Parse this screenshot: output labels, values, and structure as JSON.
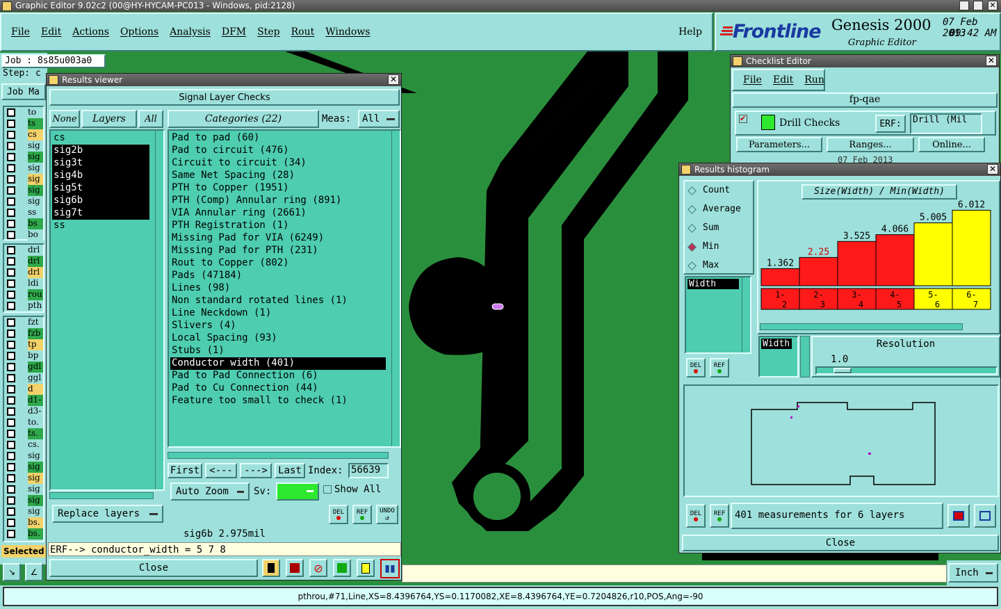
{
  "window_title": "Graphic Editor 9.02c2 (00@HY-HYCAM-PC013 - Windows, pid:2128)",
  "menu": [
    "File",
    "Edit",
    "Actions",
    "Options",
    "Analysis",
    "DFM",
    "Step",
    "Rout",
    "Windows"
  ],
  "help_label": "Help",
  "brand": {
    "logo": "Frontline",
    "product": "Genesis 2000",
    "sub": "Graphic Editor",
    "date": "07 Feb 2013",
    "time": "09:42 AM"
  },
  "left_panel": {
    "job": "Job : 8s85u003a0",
    "step": "Step: c",
    "job_button": "Job Ma",
    "layers_a": [
      "to",
      "ts",
      "cs",
      "sig",
      "sig",
      "sig",
      "sig",
      "sig",
      "sig",
      "ss",
      "bs",
      "bo"
    ],
    "layers_b": [
      "drl",
      "drl",
      "drl",
      "ldi",
      "rou",
      "pth"
    ],
    "layers_c": [
      "fzt",
      "fzb",
      "tp",
      "bp",
      "gdl",
      "ggl",
      "d",
      "d1-",
      "d3-",
      "to.",
      "ts.",
      "cs.",
      "sig",
      "sig",
      "sig",
      "sig",
      "sig",
      "sig",
      "bs.",
      "bs."
    ],
    "selected_label": "Selected"
  },
  "results_viewer": {
    "title": "Results viewer",
    "header": "Signal Layer Checks",
    "none_label": "None",
    "layers_label": "Layers",
    "all_label": "All",
    "layers": [
      {
        "name": "cs",
        "selected": false
      },
      {
        "name": "sig2b",
        "selected": true
      },
      {
        "name": "sig3t",
        "selected": true
      },
      {
        "name": "sig4b",
        "selected": true
      },
      {
        "name": "sig5t",
        "selected": true
      },
      {
        "name": "sig6b",
        "selected": true
      },
      {
        "name": "sig7t",
        "selected": true
      },
      {
        "name": "ss",
        "selected": false
      }
    ],
    "categories_label": "Categories (22)",
    "meas_label": "Meas:",
    "meas_value": "All",
    "categories": [
      {
        "name": "Pad to pad (60)",
        "selected": false
      },
      {
        "name": "Pad to circuit (476)",
        "selected": false
      },
      {
        "name": "Circuit to circuit (34)",
        "selected": false
      },
      {
        "name": "Same Net Spacing (28)",
        "selected": false
      },
      {
        "name": "PTH to Copper (1951)",
        "selected": false
      },
      {
        "name": "PTH (Comp) Annular ring (891)",
        "selected": false
      },
      {
        "name": "VIA Annular ring (2661)",
        "selected": false
      },
      {
        "name": "PTH Registration (1)",
        "selected": false
      },
      {
        "name": "Missing Pad for VIA (6249)",
        "selected": false
      },
      {
        "name": "Missing Pad for PTH (231)",
        "selected": false
      },
      {
        "name": "Rout to Copper (802)",
        "selected": false
      },
      {
        "name": "Pads (47184)",
        "selected": false
      },
      {
        "name": "Lines (98)",
        "selected": false
      },
      {
        "name": "Non standard rotated lines (1)",
        "selected": false
      },
      {
        "name": "Line Neckdown (1)",
        "selected": false
      },
      {
        "name": "Slivers (4)",
        "selected": false
      },
      {
        "name": "Local Spacing (93)",
        "selected": false
      },
      {
        "name": "Stubs (1)",
        "selected": false
      },
      {
        "name": "Conductor width (401)",
        "selected": true
      },
      {
        "name": "Pad to Pad Connection (6)",
        "selected": false
      },
      {
        "name": "Pad to Cu Connection (44)",
        "selected": false
      },
      {
        "name": "Feature too small to check (1)",
        "selected": false
      }
    ],
    "first_label": "First",
    "prev_label": "<---",
    "next_label": "--->",
    "last_label": "Last",
    "index_label": "Index:",
    "index_value": "56639",
    "auto_zoom_label": "Auto Zoom",
    "sv_label": "Sv:",
    "show_all_label": "Show All",
    "replace_layers_label": "Replace layers",
    "del_label": "DEL",
    "ref_label": "REF",
    "undo_label": "UNDO",
    "status_line": "sig6b 2.975mil",
    "erf_line": "ERF--> conductor_width = 5 7 8",
    "close_label": "Close"
  },
  "checklist_editor": {
    "title": "Checklist Editor",
    "menu": [
      "File",
      "Edit",
      "Run"
    ],
    "name": "fp-qae",
    "check_name": "Drill Checks",
    "erf_label": "ERF:",
    "erf_value": "Drill (Mil",
    "parameters_label": "Parameters...",
    "ranges_label": "Ranges...",
    "online_label": "Online...",
    "date_partial": "07 Feb 2013"
  },
  "histogram": {
    "title": "Results histogram",
    "modes": [
      {
        "label": "Count",
        "selected": false
      },
      {
        "label": "Average",
        "selected": false
      },
      {
        "label": "Sum",
        "selected": false
      },
      {
        "label": "Min",
        "selected": true
      },
      {
        "label": "Max",
        "selected": false
      }
    ],
    "field_item": "Width",
    "chart_title": "Size(Width) / Min(Width)",
    "resolution_label": "Resolution",
    "resolution_value": "1.0",
    "width_item": "Width",
    "measurements_text": "401 measurements for 6 layers",
    "close_label": "Close",
    "del_label": "DEL",
    "ref_label": "REF"
  },
  "chart_data": {
    "type": "bar",
    "title": "Size(Width) / Min(Width)",
    "categories": [
      "1-2",
      "2-3",
      "3-4",
      "4-5",
      "5-6",
      "6-7"
    ],
    "values": [
      1.362,
      2.25,
      3.525,
      4.066,
      5.005,
      6.012
    ],
    "value_labels": [
      "1.362",
      "2.25",
      "3.525",
      "4.066",
      "5.005",
      "6.012"
    ],
    "colors": [
      "#ff1a1a",
      "#ff1a1a",
      "#ff1a1a",
      "#ff1a1a",
      "#ffff00",
      "#ffff00"
    ],
    "label_colors": [
      "#000000",
      "#cc0000",
      "#000000",
      "#000000",
      "#000000",
      "#000000"
    ],
    "ylim": [
      0,
      6.2
    ]
  },
  "units": "Inch",
  "status_bar": "pthrou,#71,Line,XS=8.4396764,YS=0.1170082,XE=8.4396764,YE=0.7204826,r10,POS,Ang=-90",
  "colors": {
    "canvas": "#2a8f3d",
    "panel": "#9ee0db",
    "list": "#4ecdb0",
    "title": "#555555"
  }
}
